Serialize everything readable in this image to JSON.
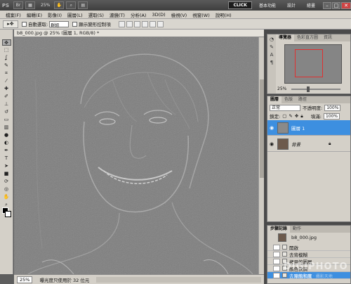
{
  "app": {
    "logo": "PS",
    "zoom": "25%"
  },
  "title_bar": {
    "workspaces": [
      {
        "label": "CLICK",
        "active": true
      },
      {
        "label": "基本功能",
        "active": false
      },
      {
        "label": "設計",
        "active": false
      },
      {
        "label": "繪畫",
        "active": false
      }
    ]
  },
  "menu": [
    "檔案(F)",
    "編輯(E)",
    "影像(I)",
    "圖層(L)",
    "選取(S)",
    "濾鏡(T)",
    "分析(A)",
    "3D(D)",
    "檢視(V)",
    "視窗(W)",
    "說明(H)"
  ],
  "options_bar": {
    "auto_select_label": "自動選取:",
    "auto_select_value": "群組",
    "show_transform_label": "顯示變形控制項"
  },
  "document": {
    "tab_title": "b8_000.jpg @ 25% (圖層 1, RGB/8) *",
    "zoom": "25%",
    "status": "曝光度只使用於 32 位元"
  },
  "panels": {
    "navigator": {
      "tabs": [
        "導覽器",
        "色彩直方圖",
        "資訊"
      ],
      "zoom": "25%"
    },
    "layers": {
      "tabs": [
        "圖層",
        "色版",
        "路徑"
      ],
      "blend_mode": "正常",
      "opacity_label": "不透明度:",
      "opacity_value": "100%",
      "lock_label": "鎖定:",
      "fill_label": "填滿:",
      "fill_value": "100%",
      "items": [
        {
          "name": "圖層 1",
          "selected": true
        },
        {
          "name": "背景",
          "selected": false
        }
      ]
    },
    "history": {
      "tabs": [
        "步驟記錄",
        "動作"
      ],
      "snapshot": "b8_000.jpg",
      "items": [
        {
          "label": "開啟",
          "selected": false
        },
        {
          "label": "去背模糊",
          "selected": false
        },
        {
          "label": "拷貝的圖層",
          "selected": false
        },
        {
          "label": "顏色快調",
          "selected": false
        },
        {
          "label": "去除飽和度",
          "selected": true
        }
      ]
    }
  },
  "watermark": {
    "brand": "DIGIPHOTO",
    "sub": "數位相機 · 攝影天地"
  },
  "colors": {
    "accent": "#3d8fe0",
    "active_workspace": "#1c1c1c"
  }
}
